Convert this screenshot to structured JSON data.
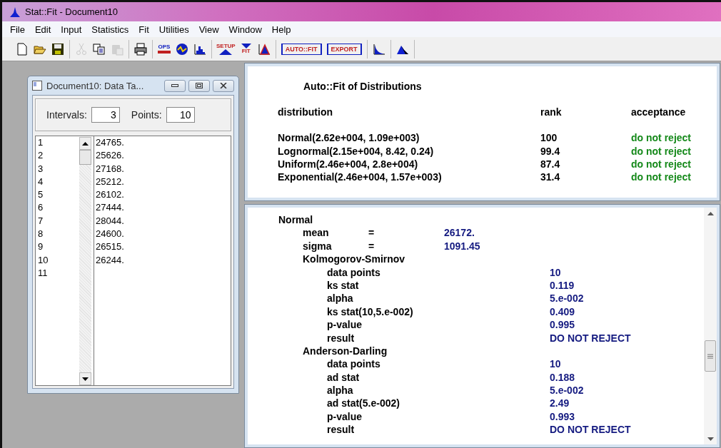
{
  "window": {
    "title": "Stat::Fit - Document10"
  },
  "menu": [
    "File",
    "Edit",
    "Input",
    "Statistics",
    "Fit",
    "Utilities",
    "View",
    "Window",
    "Help"
  ],
  "toolbar": [
    [
      {
        "kind": "new",
        "disabled": false
      },
      {
        "kind": "open",
        "disabled": false
      },
      {
        "kind": "save",
        "disabled": false
      }
    ],
    [
      {
        "kind": "cut",
        "disabled": true
      },
      {
        "kind": "copy",
        "disabled": false
      },
      {
        "kind": "paste",
        "disabled": true
      }
    ],
    [
      {
        "kind": "print",
        "disabled": false
      }
    ],
    [
      {
        "kind": "ops",
        "label": "OPS",
        "disabled": false
      },
      {
        "kind": "wave",
        "disabled": false
      },
      {
        "kind": "histogram",
        "disabled": false
      }
    ],
    [
      {
        "kind": "setup",
        "label": "SETUP",
        "disabled": false
      },
      {
        "kind": "fit",
        "label": "FIT",
        "disabled": false
      },
      {
        "kind": "compare",
        "disabled": false
      }
    ],
    [
      {
        "kind": "textbutton",
        "label": "AUTO::FIT",
        "disabled": false
      },
      {
        "kind": "textbutton",
        "label": "EXPORT",
        "disabled": false
      }
    ],
    [
      {
        "kind": "decay",
        "disabled": false
      }
    ],
    [
      {
        "kind": "peak",
        "disabled": false
      }
    ]
  ],
  "data_table": {
    "title": "Document10: Data Ta...",
    "intervals_label": "Intervals:",
    "intervals": "3",
    "points_label": "Points:",
    "points": "10",
    "rows": [
      {
        "index": "1",
        "value": "24765."
      },
      {
        "index": "2",
        "value": "25626."
      },
      {
        "index": "3",
        "value": "27168."
      },
      {
        "index": "4",
        "value": "25212."
      },
      {
        "index": "5",
        "value": "26102."
      },
      {
        "index": "6",
        "value": "27444."
      },
      {
        "index": "7",
        "value": "28044."
      },
      {
        "index": "8",
        "value": "24600."
      },
      {
        "index": "9",
        "value": "26515."
      },
      {
        "index": "10",
        "value": "26244."
      },
      {
        "index": "11"
      }
    ]
  },
  "autofit": {
    "title": "Auto::Fit of Distributions",
    "columns": [
      "distribution",
      "rank",
      "acceptance"
    ],
    "rows": [
      {
        "distribution": "Normal(2.62e+004, 1.09e+003)",
        "rank": "100",
        "acceptance": "do not reject"
      },
      {
        "distribution": "Lognormal(2.15e+004, 8.42, 0.24)",
        "rank": "99.4",
        "acceptance": "do not reject"
      },
      {
        "distribution": "Uniform(2.46e+004, 2.8e+004)",
        "rank": "87.4",
        "acceptance": "do not reject"
      },
      {
        "distribution": "Exponential(2.46e+004, 1.57e+003)",
        "rank": "31.4",
        "acceptance": "do not reject"
      }
    ]
  },
  "details": [
    {
      "label": "Normal",
      "children": [
        {
          "label": "mean",
          "sep": "=",
          "value": "26172."
        },
        {
          "label": "sigma",
          "sep": "=",
          "value": "1091.45"
        },
        {
          "label": "Kolmogorov-Smirnov",
          "children": [
            {
              "label": "data points",
              "value": "10"
            },
            {
              "label": "ks stat",
              "value": "0.119"
            },
            {
              "label": "alpha",
              "value": "5.e-002"
            },
            {
              "label": "ks stat(10,5.e-002)",
              "value": "0.409"
            },
            {
              "label": "p-value",
              "value": "0.995"
            },
            {
              "label": "result",
              "value": "DO NOT REJECT"
            }
          ]
        },
        {
          "label": "Anderson-Darling",
          "children": [
            {
              "label": "data points",
              "value": "10"
            },
            {
              "label": "ad stat",
              "value": "0.188"
            },
            {
              "label": "alpha",
              "value": "5.e-002"
            },
            {
              "label": "ad stat(5.e-002)",
              "value": "2.49"
            },
            {
              "label": "p-value",
              "value": "0.993"
            },
            {
              "label": "result",
              "value": "DO NOT REJECT"
            }
          ]
        }
      ]
    }
  ]
}
